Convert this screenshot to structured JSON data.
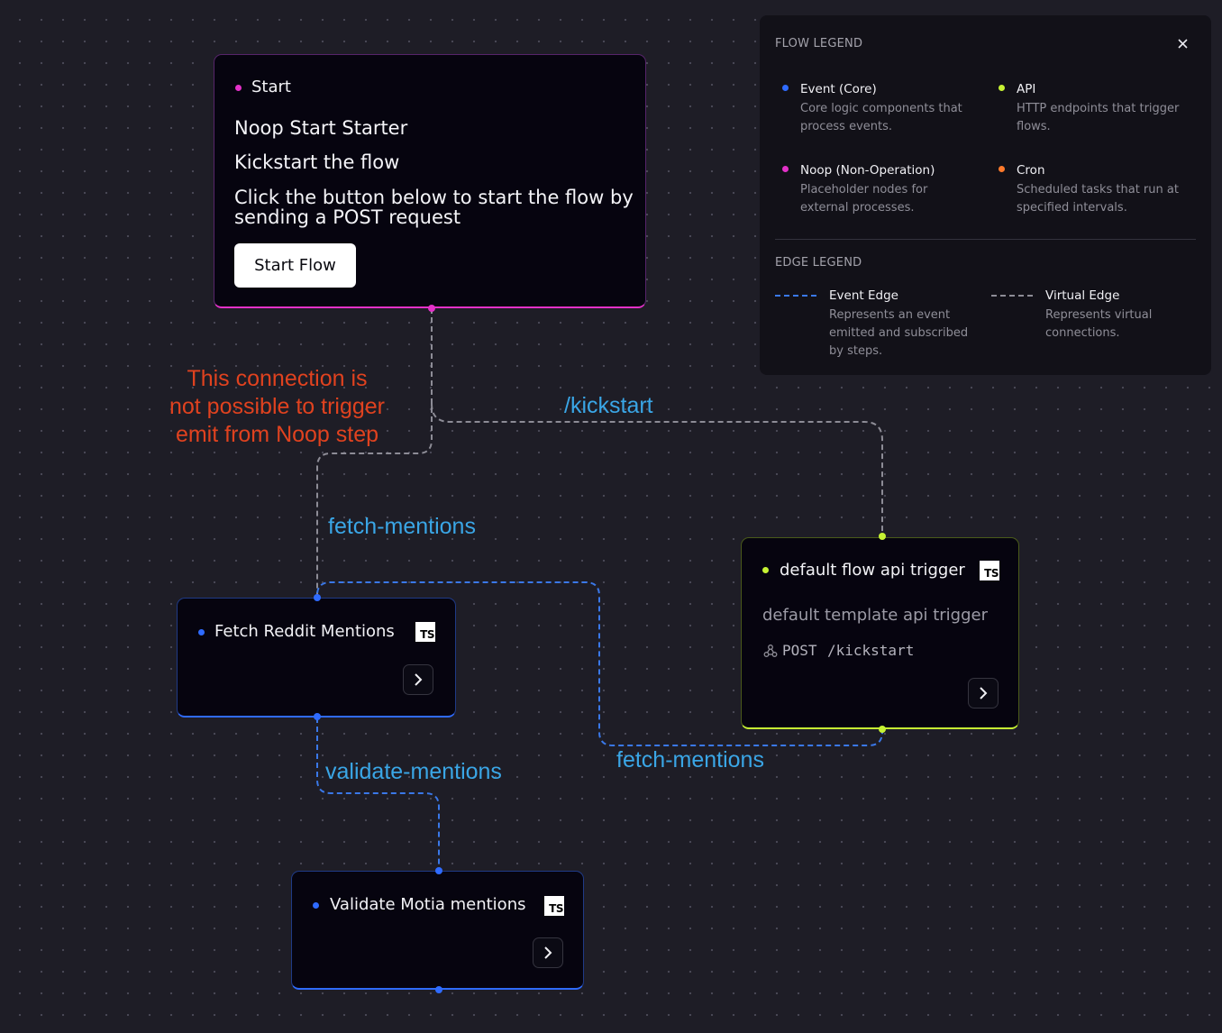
{
  "colors": {
    "event": "#2f6bff",
    "api": "#c6f233",
    "noop": "#e331c8",
    "cron": "#ff7a2b",
    "virtual_edge": "#8d8c96",
    "event_edge": "#3a78e8",
    "annotation": "#e0421f",
    "edge_label": "#3aa6e6"
  },
  "start_node": {
    "type_label": "Start",
    "title": "Noop Start Starter",
    "subtitle": "Kickstart the flow",
    "description": "Click the button below to start the flow by sending a POST request",
    "button_label": "Start Flow"
  },
  "nodes": {
    "fetch": {
      "title": "Fetch Reddit Mentions",
      "lang_badge": "TS"
    },
    "api_trigger": {
      "title": "default flow api trigger",
      "lang_badge": "TS",
      "description": "default template api trigger",
      "method": "POST",
      "path": "/kickstart"
    },
    "validate": {
      "title": "Validate Motia mentions",
      "lang_badge": "TS"
    }
  },
  "edge_labels": {
    "kickstart": "/kickstart",
    "fetch_mentions_virtual": "fetch-mentions",
    "fetch_mentions_event": "fetch-mentions",
    "validate_mentions": "validate-mentions"
  },
  "annotation": "This connection is\nnot possible to trigger\nemit from Noop step",
  "legend": {
    "flow_heading": "FLOW LEGEND",
    "close_icon": "close-icon",
    "flow_items": [
      {
        "title": "Event (Core)",
        "desc": "Core logic components that process events.",
        "color_key": "event"
      },
      {
        "title": "API",
        "desc": "HTTP endpoints that trigger flows.",
        "color_key": "api"
      },
      {
        "title": "Noop (Non-Operation)",
        "desc": "Placeholder nodes for external processes.",
        "color_key": "noop"
      },
      {
        "title": "Cron",
        "desc": "Scheduled tasks that run at specified intervals.",
        "color_key": "cron"
      }
    ],
    "edge_heading": "EDGE LEGEND",
    "edge_items": [
      {
        "title": "Event Edge",
        "desc": "Represents an event emitted and subscribed by steps."
      },
      {
        "title": "Virtual Edge",
        "desc": "Represents virtual connections."
      }
    ]
  }
}
